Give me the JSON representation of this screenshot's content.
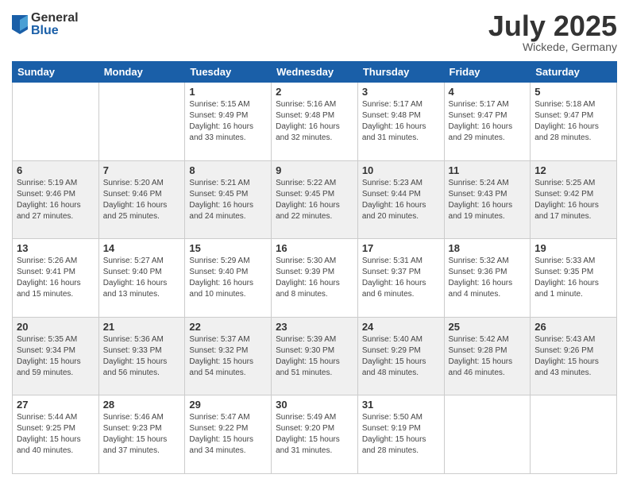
{
  "logo": {
    "general": "General",
    "blue": "Blue"
  },
  "header": {
    "month": "July 2025",
    "location": "Wickede, Germany"
  },
  "weekdays": [
    "Sunday",
    "Monday",
    "Tuesday",
    "Wednesday",
    "Thursday",
    "Friday",
    "Saturday"
  ],
  "weeks": [
    [
      {
        "day": "",
        "info": ""
      },
      {
        "day": "",
        "info": ""
      },
      {
        "day": "1",
        "info": "Sunrise: 5:15 AM\nSunset: 9:49 PM\nDaylight: 16 hours\nand 33 minutes."
      },
      {
        "day": "2",
        "info": "Sunrise: 5:16 AM\nSunset: 9:48 PM\nDaylight: 16 hours\nand 32 minutes."
      },
      {
        "day": "3",
        "info": "Sunrise: 5:17 AM\nSunset: 9:48 PM\nDaylight: 16 hours\nand 31 minutes."
      },
      {
        "day": "4",
        "info": "Sunrise: 5:17 AM\nSunset: 9:47 PM\nDaylight: 16 hours\nand 29 minutes."
      },
      {
        "day": "5",
        "info": "Sunrise: 5:18 AM\nSunset: 9:47 PM\nDaylight: 16 hours\nand 28 minutes."
      }
    ],
    [
      {
        "day": "6",
        "info": "Sunrise: 5:19 AM\nSunset: 9:46 PM\nDaylight: 16 hours\nand 27 minutes."
      },
      {
        "day": "7",
        "info": "Sunrise: 5:20 AM\nSunset: 9:46 PM\nDaylight: 16 hours\nand 25 minutes."
      },
      {
        "day": "8",
        "info": "Sunrise: 5:21 AM\nSunset: 9:45 PM\nDaylight: 16 hours\nand 24 minutes."
      },
      {
        "day": "9",
        "info": "Sunrise: 5:22 AM\nSunset: 9:45 PM\nDaylight: 16 hours\nand 22 minutes."
      },
      {
        "day": "10",
        "info": "Sunrise: 5:23 AM\nSunset: 9:44 PM\nDaylight: 16 hours\nand 20 minutes."
      },
      {
        "day": "11",
        "info": "Sunrise: 5:24 AM\nSunset: 9:43 PM\nDaylight: 16 hours\nand 19 minutes."
      },
      {
        "day": "12",
        "info": "Sunrise: 5:25 AM\nSunset: 9:42 PM\nDaylight: 16 hours\nand 17 minutes."
      }
    ],
    [
      {
        "day": "13",
        "info": "Sunrise: 5:26 AM\nSunset: 9:41 PM\nDaylight: 16 hours\nand 15 minutes."
      },
      {
        "day": "14",
        "info": "Sunrise: 5:27 AM\nSunset: 9:40 PM\nDaylight: 16 hours\nand 13 minutes."
      },
      {
        "day": "15",
        "info": "Sunrise: 5:29 AM\nSunset: 9:40 PM\nDaylight: 16 hours\nand 10 minutes."
      },
      {
        "day": "16",
        "info": "Sunrise: 5:30 AM\nSunset: 9:39 PM\nDaylight: 16 hours\nand 8 minutes."
      },
      {
        "day": "17",
        "info": "Sunrise: 5:31 AM\nSunset: 9:37 PM\nDaylight: 16 hours\nand 6 minutes."
      },
      {
        "day": "18",
        "info": "Sunrise: 5:32 AM\nSunset: 9:36 PM\nDaylight: 16 hours\nand 4 minutes."
      },
      {
        "day": "19",
        "info": "Sunrise: 5:33 AM\nSunset: 9:35 PM\nDaylight: 16 hours\nand 1 minute."
      }
    ],
    [
      {
        "day": "20",
        "info": "Sunrise: 5:35 AM\nSunset: 9:34 PM\nDaylight: 15 hours\nand 59 minutes."
      },
      {
        "day": "21",
        "info": "Sunrise: 5:36 AM\nSunset: 9:33 PM\nDaylight: 15 hours\nand 56 minutes."
      },
      {
        "day": "22",
        "info": "Sunrise: 5:37 AM\nSunset: 9:32 PM\nDaylight: 15 hours\nand 54 minutes."
      },
      {
        "day": "23",
        "info": "Sunrise: 5:39 AM\nSunset: 9:30 PM\nDaylight: 15 hours\nand 51 minutes."
      },
      {
        "day": "24",
        "info": "Sunrise: 5:40 AM\nSunset: 9:29 PM\nDaylight: 15 hours\nand 48 minutes."
      },
      {
        "day": "25",
        "info": "Sunrise: 5:42 AM\nSunset: 9:28 PM\nDaylight: 15 hours\nand 46 minutes."
      },
      {
        "day": "26",
        "info": "Sunrise: 5:43 AM\nSunset: 9:26 PM\nDaylight: 15 hours\nand 43 minutes."
      }
    ],
    [
      {
        "day": "27",
        "info": "Sunrise: 5:44 AM\nSunset: 9:25 PM\nDaylight: 15 hours\nand 40 minutes."
      },
      {
        "day": "28",
        "info": "Sunrise: 5:46 AM\nSunset: 9:23 PM\nDaylight: 15 hours\nand 37 minutes."
      },
      {
        "day": "29",
        "info": "Sunrise: 5:47 AM\nSunset: 9:22 PM\nDaylight: 15 hours\nand 34 minutes."
      },
      {
        "day": "30",
        "info": "Sunrise: 5:49 AM\nSunset: 9:20 PM\nDaylight: 15 hours\nand 31 minutes."
      },
      {
        "day": "31",
        "info": "Sunrise: 5:50 AM\nSunset: 9:19 PM\nDaylight: 15 hours\nand 28 minutes."
      },
      {
        "day": "",
        "info": ""
      },
      {
        "day": "",
        "info": ""
      }
    ]
  ]
}
